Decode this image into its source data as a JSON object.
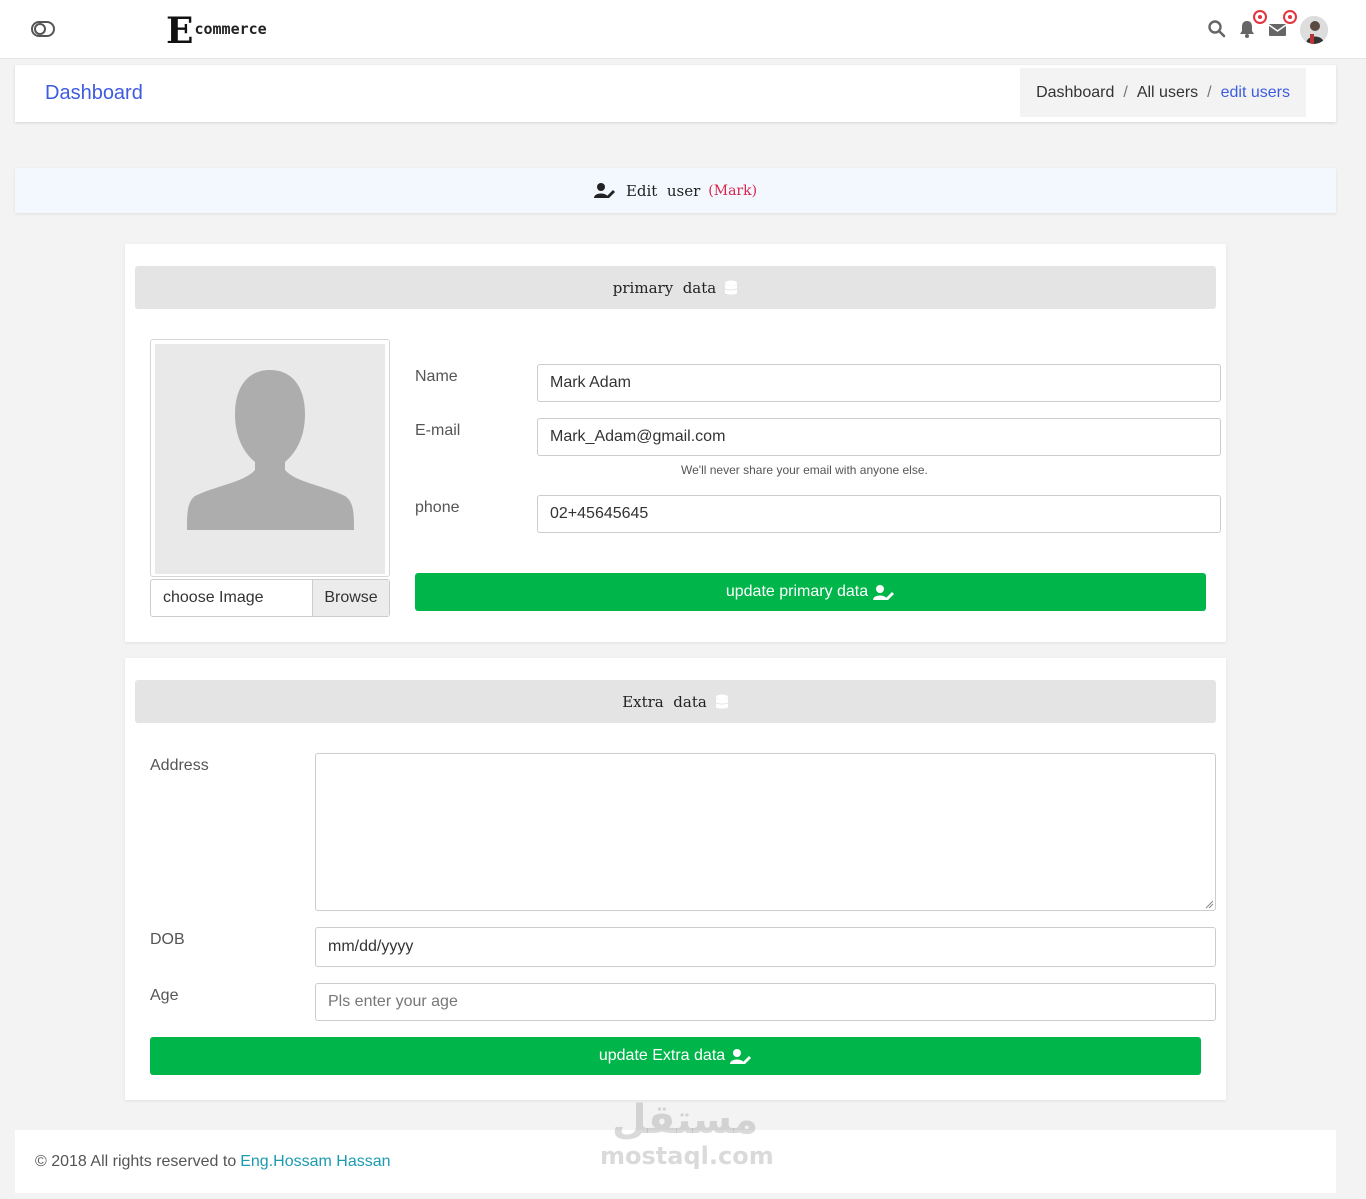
{
  "brand": {
    "initial": "E",
    "rest": "commerce"
  },
  "nav": {
    "icons": [
      "toggle-icon",
      "search-icon",
      "bell-icon",
      "envelope-icon",
      "user-avatar"
    ]
  },
  "header": {
    "title": "Dashboard",
    "breadcrumb": [
      "Dashboard",
      "All users",
      "edit users"
    ],
    "separator": "/"
  },
  "banner": {
    "text": "Edit  user",
    "user": "(Mark)"
  },
  "primary": {
    "heading": "primary  data",
    "file_label": "choose Image",
    "browse_label": "Browse",
    "name_label": "Name",
    "name_value": "Mark Adam",
    "email_label": "E-mail",
    "email_value": "Mark_Adam@gmail.com",
    "email_help": "We'll never share your email with anyone else.",
    "phone_label": "phone",
    "phone_value": "02+45645645",
    "submit_label": "update primary data"
  },
  "extra": {
    "heading": "Extra  data",
    "address_label": "Address",
    "address_value": "",
    "dob_label": "DOB",
    "dob_placeholder": "mm/dd/yyyy",
    "age_label": "Age",
    "age_placeholder": "Pls enter your age",
    "submit_label": "update Extra data"
  },
  "footer": {
    "text": "© 2018 All rights reserved to",
    "author": "Eng.Hossam Hassan"
  },
  "watermark": {
    "arabic": "مستقل",
    "latin": "mostaql.com"
  },
  "colors": {
    "accent": "#3d5bdf",
    "success": "#00b54a",
    "danger": "#d6264c",
    "link": "#1a9bb0"
  }
}
